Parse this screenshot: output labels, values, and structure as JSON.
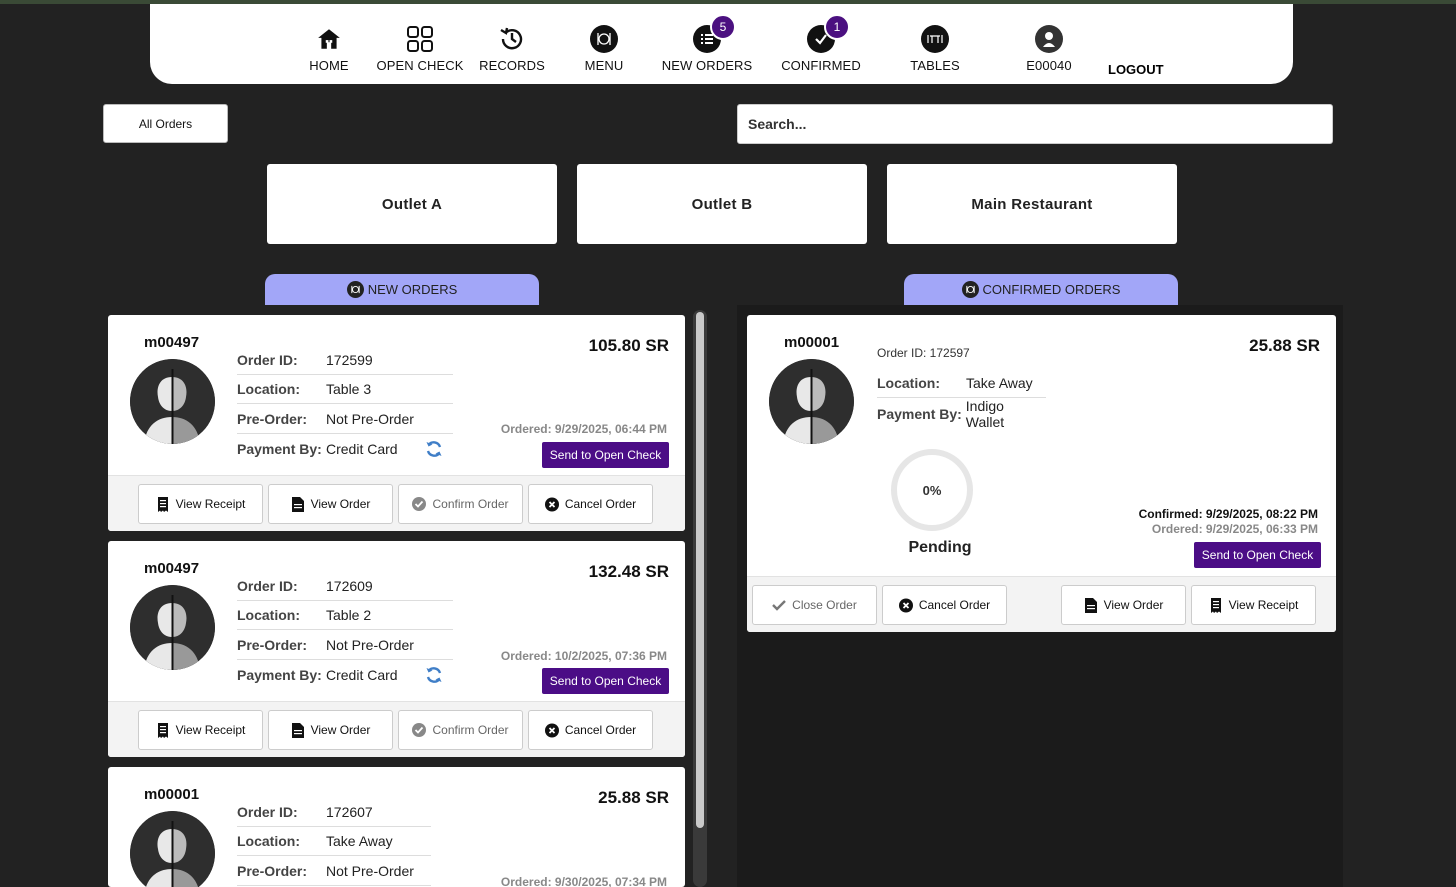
{
  "nav": {
    "items": [
      {
        "label": "HOME",
        "icon": "home-icon"
      },
      {
        "label": "OPEN CHECK",
        "icon": "grid-icon"
      },
      {
        "label": "RECORDS",
        "icon": "history-icon"
      },
      {
        "label": "MENU",
        "icon": "utensils-icon"
      },
      {
        "label": "NEW ORDERS",
        "icon": "list-icon",
        "badge": "5"
      },
      {
        "label": "CONFIRMED",
        "icon": "check-icon",
        "badge": "1"
      },
      {
        "label": "TABLES",
        "icon": "table-icon"
      },
      {
        "label": "E00040",
        "icon": "user-icon"
      }
    ],
    "logout": "LOGOUT"
  },
  "filter": {
    "all_orders": "All Orders",
    "search_placeholder": "Search..."
  },
  "outlets": [
    "Outlet A",
    "Outlet B",
    "Main Restaurant"
  ],
  "sections": {
    "new_orders": "NEW ORDERS",
    "confirmed_orders": "CONFIRMED ORDERS"
  },
  "labels": {
    "order_id": "Order ID:",
    "location": "Location:",
    "pre_order": "Pre-Order:",
    "payment_by": "Payment By:",
    "send_to_open_check": "Send to Open Check",
    "view_receipt": "View Receipt",
    "view_order": "View Order",
    "confirm_order": "Confirm Order",
    "cancel_order": "Cancel Order",
    "close_order": "Close Order"
  },
  "new_orders": [
    {
      "customer": "m00497",
      "order_id": "172599",
      "location": "Table 3",
      "pre_order": "Not Pre-Order",
      "payment_by": "Credit Card",
      "amount": "105.80 SR",
      "ordered": "Ordered: 9/29/2025, 06:44 PM"
    },
    {
      "customer": "m00497",
      "order_id": "172609",
      "location": "Table 2",
      "pre_order": "Not Pre-Order",
      "payment_by": "Credit Card",
      "amount": "132.48 SR",
      "ordered": "Ordered: 10/2/2025, 07:36 PM"
    },
    {
      "customer": "m00001",
      "order_id": "172607",
      "location": "Take Away",
      "pre_order": "Not Pre-Order",
      "payment_by": "",
      "amount": "25.88 SR",
      "ordered": "Ordered: 9/30/2025, 07:34 PM"
    }
  ],
  "confirmed_orders": [
    {
      "customer": "m00001",
      "order_id_line": "Order ID: 172597",
      "location": "Take Away",
      "payment_by": "Indigo Wallet",
      "amount": "25.88 SR",
      "progress": "0%",
      "progress_value": 0,
      "status": "Pending",
      "confirmed": "Confirmed: 9/29/2025, 08:22 PM",
      "ordered": "Ordered: 9/29/2025, 06:33 PM"
    }
  ],
  "colors": {
    "accent": "#4b0d86",
    "tab": "#a2a6f8",
    "background": "#222222"
  }
}
